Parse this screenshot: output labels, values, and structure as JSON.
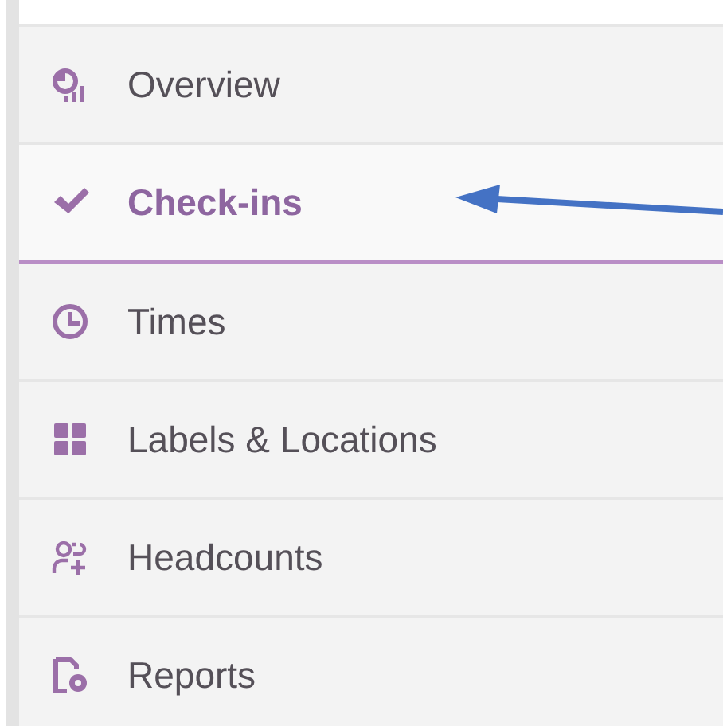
{
  "menu": {
    "items": [
      {
        "kind": "overview",
        "label": "Overview",
        "selected": false
      },
      {
        "kind": "checkins",
        "label": "Check-ins",
        "selected": true
      },
      {
        "kind": "times",
        "label": "Times",
        "selected": false
      },
      {
        "kind": "labels",
        "label": "Labels & Locations",
        "selected": false
      },
      {
        "kind": "headcounts",
        "label": "Headcounts",
        "selected": false
      },
      {
        "kind": "reports",
        "label": "Reports",
        "selected": false
      }
    ]
  }
}
